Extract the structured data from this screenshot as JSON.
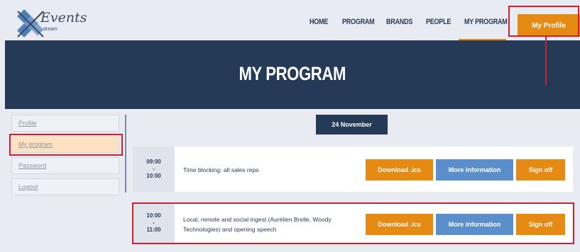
{
  "header": {
    "logo": {
      "text": "Events",
      "subtext": "dream"
    },
    "nav": [
      "HOME",
      "PROGRAM",
      "BRANDS",
      "PEOPLE",
      "MY PROGRAM"
    ],
    "profile_button": "My Profile"
  },
  "banner": {
    "title": "MY PROGRAM"
  },
  "sidebar": {
    "items": [
      {
        "label": "Profile"
      },
      {
        "label": "My program"
      },
      {
        "label": "Password"
      },
      {
        "label": "Logout"
      }
    ]
  },
  "main": {
    "date": "24 November",
    "sessions": [
      {
        "time_start": "09:00",
        "separator": "-",
        "time_end": "10:00",
        "title": "Time blocking: all sales reps",
        "download_label": "Download .ics",
        "info_label": "More information",
        "signoff_label": "Sign off"
      },
      {
        "time_start": "10:00",
        "separator": "-",
        "time_end": "11:00",
        "title": "Local, remote and social ingest (Aurélien Brelle, Woody Technologies) and opening speech",
        "download_label": "Download .ics",
        "info_label": "More information",
        "signoff_label": "Sign off"
      }
    ]
  },
  "colors": {
    "navy": "#253a57",
    "orange": "#e58a12",
    "blue": "#5b8fcb",
    "highlight": "#d0202b"
  }
}
